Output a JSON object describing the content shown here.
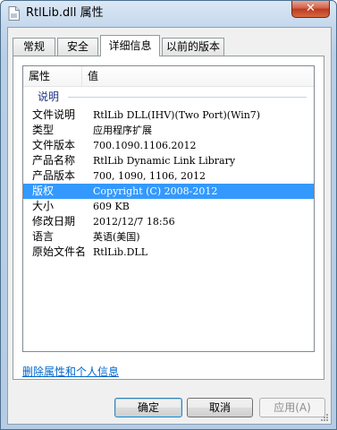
{
  "window": {
    "title": "RtlLib.dll 属性",
    "close_glyph": "✕"
  },
  "tabs": [
    {
      "label": "常规"
    },
    {
      "label": "安全"
    },
    {
      "label": "详细信息",
      "active": true
    },
    {
      "label": "以前的版本"
    }
  ],
  "details": {
    "headers": {
      "property": "属性",
      "value": "值"
    },
    "group": "说明",
    "rows": [
      {
        "key": "文件说明",
        "value": "RtlLib DLL(IHV)(Two Port)(Win7)"
      },
      {
        "key": "类型",
        "value": "应用程序扩展"
      },
      {
        "key": "文件版本",
        "value": "700.1090.1106.2012"
      },
      {
        "key": "产品名称",
        "value": "RtlLib Dynamic Link Library"
      },
      {
        "key": "产品版本",
        "value": "700, 1090, 1106, 2012"
      },
      {
        "key": "版权",
        "value": "Copyright (C) 2008-2012",
        "selected": true
      },
      {
        "key": "大小",
        "value": "609 KB"
      },
      {
        "key": "修改日期",
        "value": "2012/12/7 18:56"
      },
      {
        "key": "语言",
        "value": "英语(美国)"
      },
      {
        "key": "原始文件名",
        "value": "RtlLib.DLL"
      }
    ]
  },
  "link": "删除属性和个人信息",
  "buttons": {
    "ok": "确定",
    "cancel": "取消",
    "apply": "应用(A)"
  },
  "colors": {
    "selection": "#3399ff",
    "link": "#0066cc",
    "close": "#c7462c"
  }
}
